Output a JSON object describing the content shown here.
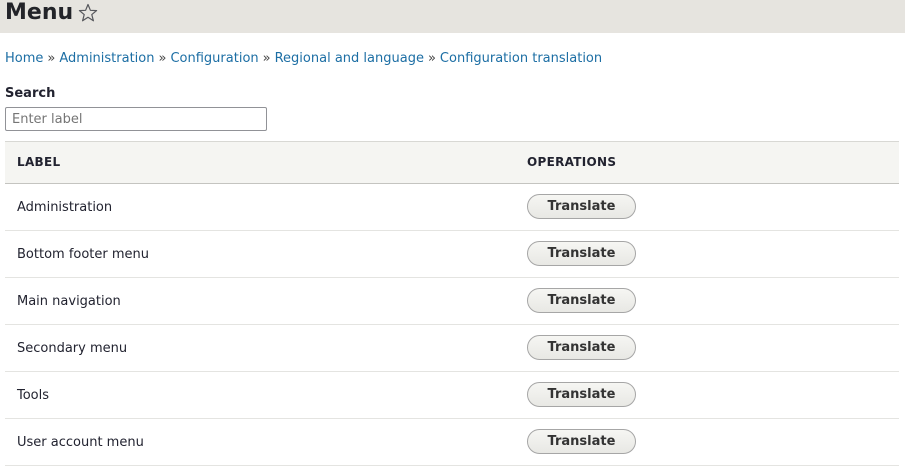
{
  "header": {
    "title": "Menu",
    "shortcut_icon": "star-outline-icon"
  },
  "breadcrumb": [
    {
      "label": "Home"
    },
    {
      "label": "Administration"
    },
    {
      "label": "Configuration"
    },
    {
      "label": "Regional and language"
    },
    {
      "label": "Configuration translation"
    }
  ],
  "breadcrumb_separator": "»",
  "search": {
    "label": "Search",
    "placeholder": "Enter label",
    "value": ""
  },
  "table": {
    "columns": [
      "LABEL",
      "OPERATIONS"
    ],
    "rows": [
      {
        "label": "Administration",
        "operation": "Translate"
      },
      {
        "label": "Bottom footer menu",
        "operation": "Translate"
      },
      {
        "label": "Main navigation",
        "operation": "Translate"
      },
      {
        "label": "Secondary menu",
        "operation": "Translate"
      },
      {
        "label": "Tools",
        "operation": "Translate"
      },
      {
        "label": "User account menu",
        "operation": "Translate"
      }
    ]
  },
  "colors": {
    "header_bg": "#e6e4df",
    "link": "#1c6ea4",
    "table_header_bg": "#f5f5f2"
  }
}
